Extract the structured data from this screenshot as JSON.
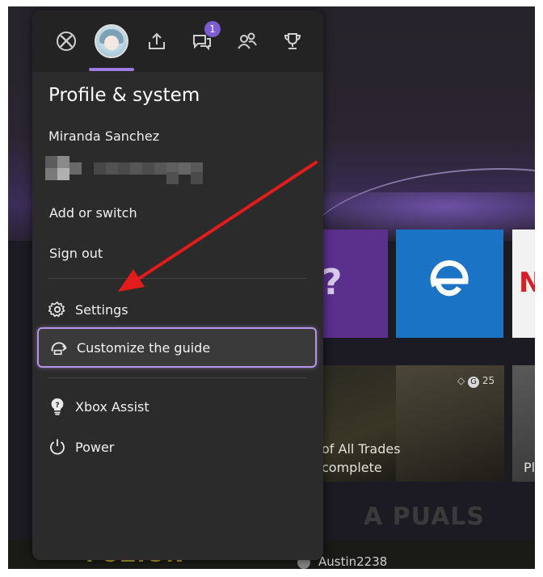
{
  "topbar": {
    "tabs": [
      {
        "name": "xbox",
        "icon": "xbox-logo-icon"
      },
      {
        "name": "profile",
        "icon": "avatar",
        "selected": true
      },
      {
        "name": "share",
        "icon": "share-icon"
      },
      {
        "name": "chat",
        "icon": "chat-icon",
        "badge": "1"
      },
      {
        "name": "people",
        "icon": "people-icon"
      },
      {
        "name": "achievements",
        "icon": "trophy-icon"
      }
    ],
    "chat_badge": "1"
  },
  "panel": {
    "title": "Profile & system",
    "user_name": "Miranda Sanchez"
  },
  "menu": {
    "add_switch": "Add or switch",
    "sign_out": "Sign out",
    "settings": "Settings",
    "customize_guide": "Customize the guide",
    "xbox_assist": "Xbox Assist",
    "power": "Power"
  },
  "background": {
    "tiles": [
      "help-tile",
      "edge-tile",
      "netflix-tile"
    ],
    "game_title_line1": "of All Trades",
    "game_title_line2": "complete",
    "game_title_partial": "Pl",
    "gamerscore": "25",
    "footer_game_logo": "FUZION",
    "friend_gamertag": "Austin2238",
    "watermark": "A PUALS"
  },
  "colors": {
    "accent": "#9c7ce0",
    "panel_bg": "#2b2b2b",
    "focus_border": "#b394e6",
    "arrow": "#e21b1b"
  }
}
